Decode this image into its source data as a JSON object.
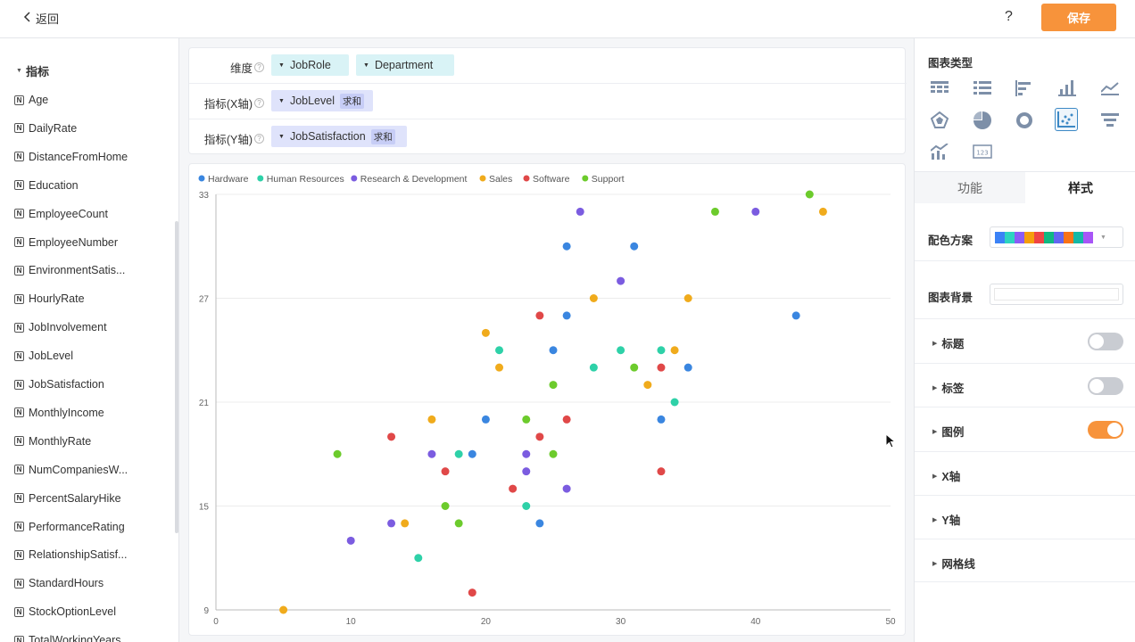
{
  "topbar": {
    "back_label": "返回",
    "help_label": "?",
    "save_label": "保存"
  },
  "sidebar": {
    "section_label": "指标",
    "items": [
      "Age",
      "DailyRate",
      "DistanceFromHome",
      "Education",
      "EmployeeCount",
      "EmployeeNumber",
      "EnvironmentSatis...",
      "HourlyRate",
      "JobInvolvement",
      "JobLevel",
      "JobSatisfaction",
      "MonthlyIncome",
      "MonthlyRate",
      "NumCompaniesW...",
      "PercentSalaryHike",
      "PerformanceRating",
      "RelationshipSatisf...",
      "StandardHours",
      "StockOptionLevel",
      "TotalWorkingYears"
    ]
  },
  "config": {
    "dimension_label": "维度",
    "dimensions": [
      "JobRole",
      "Department"
    ],
    "x_label": "指标(X轴)",
    "x_field": "JobLevel",
    "x_agg": "求和",
    "y_label": "指标(Y轴)",
    "y_field": "JobSatisfaction",
    "y_agg": "求和"
  },
  "right_panel": {
    "chart_type_title": "图表类型",
    "tabs": [
      "功能",
      "样式"
    ],
    "color_scheme_label": "配色方案",
    "background_label": "图表背景",
    "palette": [
      "#3b82f6",
      "#2dd4bf",
      "#8b5cf6",
      "#f59e0b",
      "#ef4444",
      "#10b981",
      "#6366f1",
      "#f97316",
      "#14b8a6",
      "#a855f7"
    ],
    "sections": [
      {
        "label": "标题",
        "toggle": false
      },
      {
        "label": "标签",
        "toggle": false
      },
      {
        "label": "图例",
        "toggle": true
      },
      {
        "label": "X轴"
      },
      {
        "label": "Y轴"
      },
      {
        "label": "网格线"
      }
    ]
  },
  "chart_data": {
    "type": "scatter",
    "xlim": [
      0,
      50
    ],
    "ylim": [
      9,
      33
    ],
    "x_ticks": [
      0,
      10,
      20,
      30,
      40,
      50
    ],
    "y_ticks": [
      9,
      15,
      21,
      27,
      33
    ],
    "grid": "horizontal",
    "legend": "top-left",
    "series": [
      {
        "name": "Hardware",
        "color": "#3a86e0",
        "points": [
          [
            26,
            30
          ],
          [
            31,
            30
          ],
          [
            26,
            26
          ],
          [
            25,
            24
          ],
          [
            43,
            26
          ],
          [
            35,
            23
          ],
          [
            20,
            20
          ],
          [
            33,
            20
          ],
          [
            19,
            18
          ],
          [
            24,
            14
          ]
        ]
      },
      {
        "name": "Human Resources",
        "color": "#2ed1a8",
        "points": [
          [
            21,
            24
          ],
          [
            30,
            24
          ],
          [
            33,
            24
          ],
          [
            28,
            23
          ],
          [
            34,
            21
          ],
          [
            18,
            18
          ],
          [
            23,
            15
          ],
          [
            15,
            12
          ]
        ]
      },
      {
        "name": "Research & Development",
        "color": "#7b5ce0",
        "points": [
          [
            27,
            32
          ],
          [
            40,
            32
          ],
          [
            30,
            28
          ],
          [
            16,
            18
          ],
          [
            23,
            18
          ],
          [
            23,
            17
          ],
          [
            26,
            16
          ],
          [
            13,
            14
          ],
          [
            10,
            13
          ]
        ]
      },
      {
        "name": "Sales",
        "color": "#f0ab1c",
        "points": [
          [
            45,
            32
          ],
          [
            28,
            27
          ],
          [
            35,
            27
          ],
          [
            20,
            25
          ],
          [
            21,
            23
          ],
          [
            34,
            24
          ],
          [
            32,
            22
          ],
          [
            16,
            20
          ],
          [
            14,
            14
          ],
          [
            5,
            9
          ]
        ]
      },
      {
        "name": "Software",
        "color": "#e04848",
        "points": [
          [
            24,
            26
          ],
          [
            33,
            23
          ],
          [
            26,
            20
          ],
          [
            13,
            19
          ],
          [
            24,
            19
          ],
          [
            17,
            17
          ],
          [
            33,
            17
          ],
          [
            22,
            16
          ],
          [
            19,
            10
          ]
        ]
      },
      {
        "name": "Support",
        "color": "#6ccb2c",
        "points": [
          [
            44,
            33
          ],
          [
            37,
            32
          ],
          [
            31,
            23
          ],
          [
            25,
            22
          ],
          [
            23,
            20
          ],
          [
            9,
            18
          ],
          [
            25,
            18
          ],
          [
            17,
            15
          ],
          [
            18,
            14
          ]
        ]
      }
    ]
  }
}
